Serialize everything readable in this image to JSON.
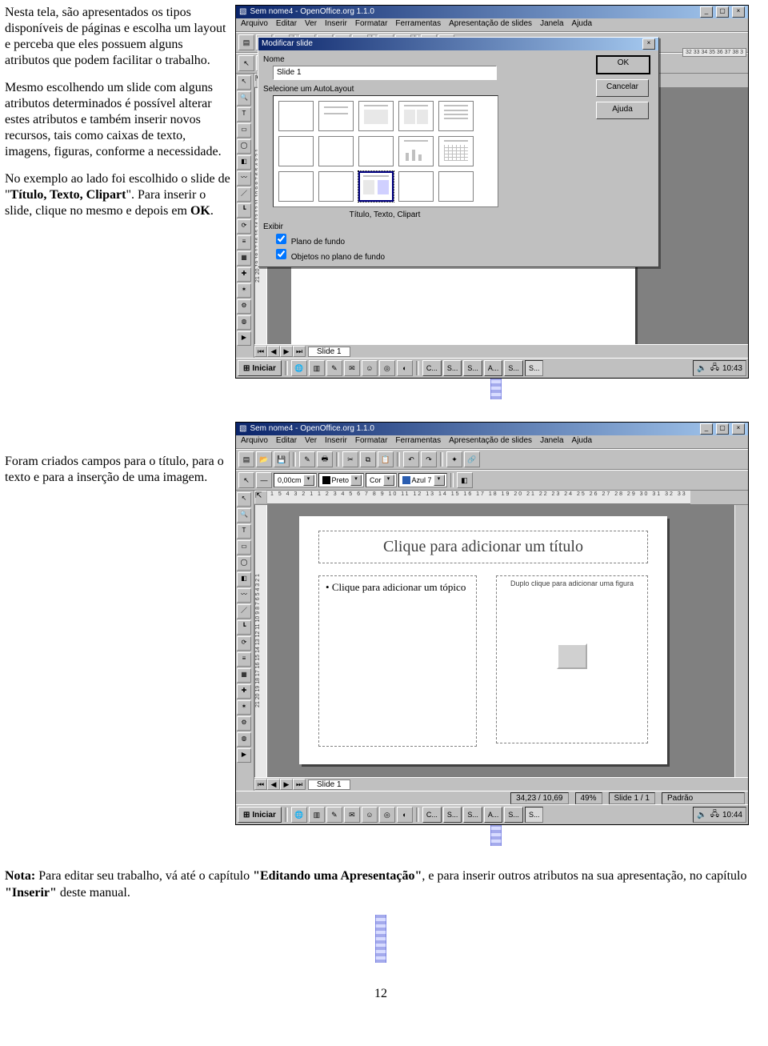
{
  "page_number": "12",
  "body": {
    "p1": "Nesta tela, são apresentados os tipos disponíveis de páginas e escolha um layout  e perceba que eles possuem alguns atributos que podem facilitar o trabalho.",
    "p2": "Mesmo escolhendo um  slide com alguns atributos determinados é possível alterar estes atributos e também inserir novos recursos, tais como caixas de texto, imagens, figuras, conforme a necessidade.",
    "p3a": "No exemplo ao lado foi escolhido o slide de \"",
    "p3b": "Título, Texto, Clipart",
    "p3c": "\". Para inserir o slide, clique no mesmo e depois em ",
    "p3d": "OK",
    "p3e": ".",
    "p4": "Foram criados campos para o título, para o texto e para a inserção de uma imagem.",
    "nota_label": "Nota:",
    "nota_1": " Para editar seu trabalho, vá até o capítulo ",
    "nota_b1": "\"Editando uma Apresentação\"",
    "nota_2": ",  e para inserir outros atributos na sua apresentação, no capítulo ",
    "nota_b2": "\"Inserir\"",
    "nota_3": " deste manual."
  },
  "app": {
    "title": "Sem nome4 - OpenOffice.org 1.1.0",
    "menu": [
      "Arquivo",
      "Editar",
      "Ver",
      "Inserir",
      "Formatar",
      "Ferramentas",
      "Apresentação de slides",
      "Janela",
      "Ajuda"
    ],
    "slide_tab": "Slide 1",
    "taskbar_start": "Iniciar",
    "task_items": [
      "C...",
      "S...",
      "S...",
      "A...",
      "S...",
      "S..."
    ],
    "clock1": "10:43",
    "clock2": "10:44",
    "ruler_h1": "1  2  3  4  5",
    "ruler_h2": "1  5  4  3  2  1     1  2  3  4  5  6  7  8  9  10 11 12 13 14 15 16 17 18 19 20 21 22 23 24 25 26 27 28 29 30 31 32 33",
    "ruler_h_right": "32 33 34 35 36 37 38 3",
    "ruler_v": "21 20 19 18 17 16 15 14 13 12 11 10 9 8 7 6 5 4 3 2 1"
  },
  "dialog": {
    "title": "Modificar slide",
    "nome_label": "Nome",
    "nome_value": "Slide 1",
    "autolayout_label": "Selecione um AutoLayout",
    "selected_label": "Título, Texto, Clipart",
    "exibir_label": "Exibir",
    "cb1": "Plano de fundo",
    "cb2": "Objetos no plano de fundo",
    "ok": "OK",
    "cancel": "Cancelar",
    "help": "Ajuda"
  },
  "shot2": {
    "combo_width": "0,00cm",
    "combo_color1": "Preto",
    "combo_color_lbl": "Cor",
    "combo_color2": "Azul 7",
    "ph_title": "Clique para adicionar um título",
    "ph_text": "Clique para adicionar um tópico",
    "ph_clip": "Duplo clique para adicionar uma figura",
    "status_pos": "34,23 / 10,69",
    "status_zoom": "49%",
    "status_slide": "Slide 1 / 1",
    "status_mode": "Padrão"
  }
}
